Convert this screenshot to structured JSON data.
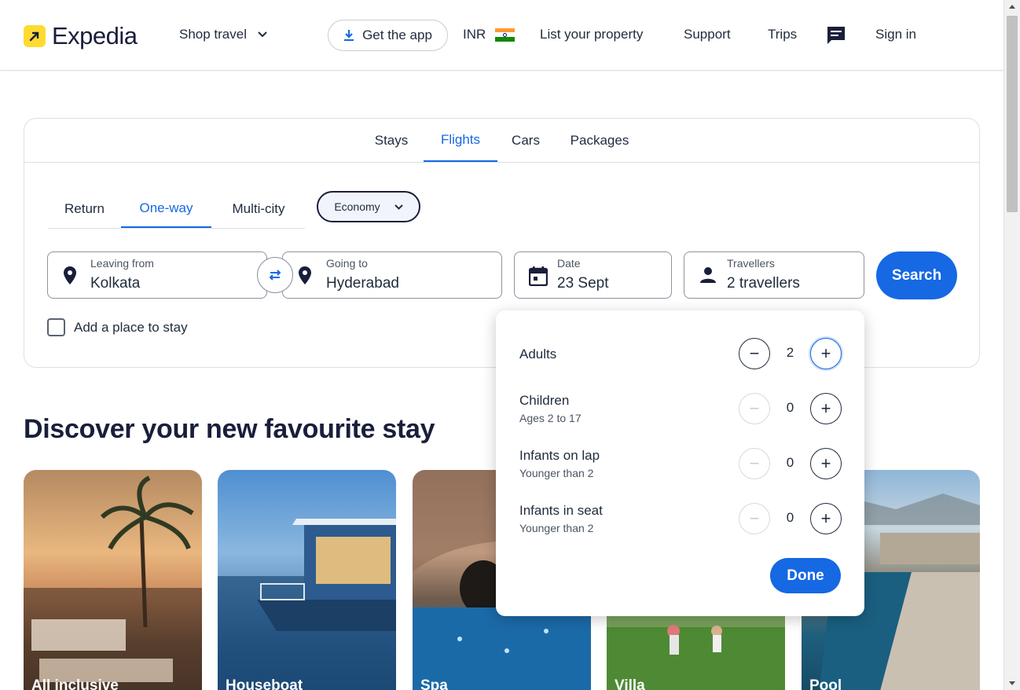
{
  "header": {
    "logo_text": "Expedia",
    "shop_travel": "Shop travel",
    "get_app": "Get the app",
    "currency": "INR",
    "list_property": "List your property",
    "support": "Support",
    "trips": "Trips",
    "sign_in": "Sign in"
  },
  "tabs": [
    {
      "label": "Stays",
      "active": false
    },
    {
      "label": "Flights",
      "active": true
    },
    {
      "label": "Cars",
      "active": false
    },
    {
      "label": "Packages",
      "active": false
    }
  ],
  "trip_types": [
    {
      "label": "Return",
      "active": false
    },
    {
      "label": "One-way",
      "active": true
    },
    {
      "label": "Multi-city",
      "active": false
    }
  ],
  "cabin_class": "Economy",
  "fields": {
    "leaving": {
      "label": "Leaving from",
      "value": "Kolkata"
    },
    "going": {
      "label": "Going to",
      "value": "Hyderabad"
    },
    "date": {
      "label": "Date",
      "value": "23 Sept"
    },
    "travellers": {
      "label": "Travellers",
      "value": "2 travellers"
    }
  },
  "search_label": "Search",
  "add_place": "Add a place to stay",
  "discover_heading": "Discover your new favourite stay",
  "stay_cards": [
    {
      "label": "All inclusive"
    },
    {
      "label": "Houseboat"
    },
    {
      "label": "Spa"
    },
    {
      "label": "Villa"
    },
    {
      "label": "Pool"
    }
  ],
  "travellers_popup": {
    "rows": [
      {
        "label": "Adults",
        "sub": "",
        "value": 2
      },
      {
        "label": "Children",
        "sub": "Ages 2 to 17",
        "value": 0
      },
      {
        "label": "Infants on lap",
        "sub": "Younger than 2",
        "value": 0
      },
      {
        "label": "Infants in seat",
        "sub": "Younger than 2",
        "value": 0
      }
    ],
    "done_label": "Done"
  },
  "colors": {
    "accent": "#1668e3",
    "logo_yellow": "#fddb32",
    "text": "#1f2b3d"
  }
}
